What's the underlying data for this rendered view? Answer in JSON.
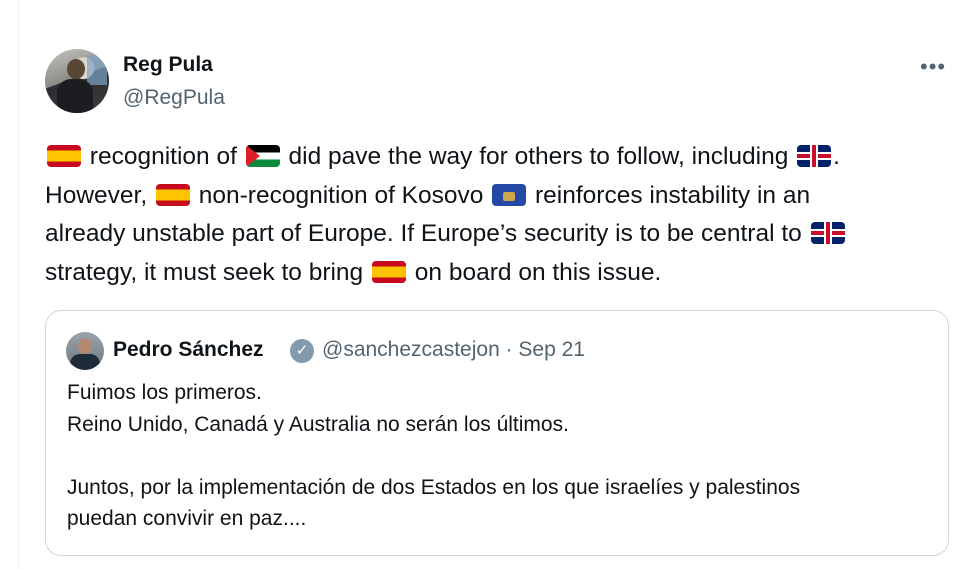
{
  "author": {
    "name": "Reg Pula",
    "handle": "@RegPula",
    "more_label": "•••"
  },
  "tweet": {
    "lines": [
      {
        "parts": [
          {
            "flag": "spain"
          },
          {
            "text": " recognition of "
          },
          {
            "flag": "palestine"
          },
          {
            "text": " did pave the way for others to follow, including "
          },
          {
            "flag": "uk"
          },
          {
            "text": "."
          }
        ]
      },
      {
        "parts": [
          {
            "text": "However, "
          },
          {
            "flag": "spain"
          },
          {
            "text": " non-recognition of Kosovo "
          },
          {
            "flag": "kosovo"
          },
          {
            "text": " reinforces instability in an"
          }
        ]
      },
      {
        "parts": [
          {
            "text": "already unstable part of Europe. If Europe’s security is to be central to "
          },
          {
            "flag": "uk"
          }
        ]
      },
      {
        "parts": [
          {
            "text": "strategy, it must seek to bring "
          },
          {
            "flag": "spain"
          },
          {
            "text": " on board on this issue."
          }
        ]
      }
    ]
  },
  "quoted": {
    "name": "Pedro Sánchez",
    "verified_icon": "verified-badge-icon",
    "handle_date": "@sanchezcastejon · Sep 21",
    "lines": [
      "Fuimos los primeros.",
      "Reino Unido, Canadá y Australia no serán los últimos.",
      "",
      "Juntos, por la implementación de dos Estados en los que israelíes y palestinos",
      "puedan convivir en paz...."
    ]
  },
  "colors": {
    "text": "#0f1419",
    "secondary": "#536471",
    "border": "#cfd9de",
    "verified": "#829aab"
  }
}
